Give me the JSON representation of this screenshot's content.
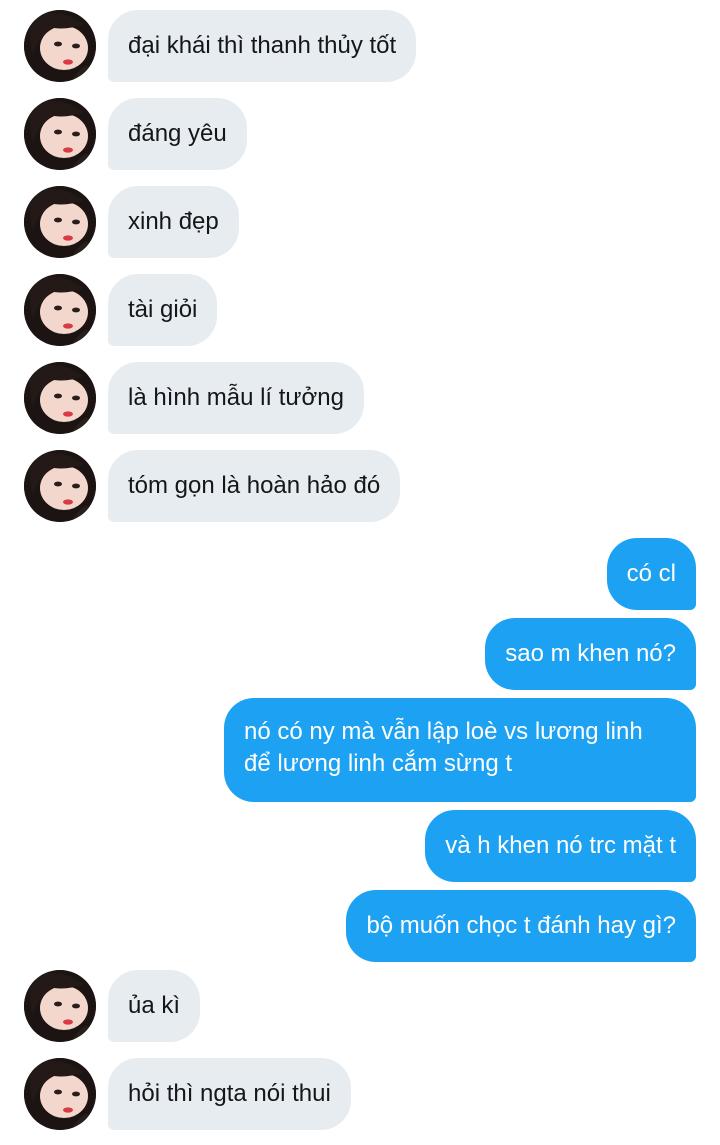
{
  "colors": {
    "incoming_bubble": "#e6ecf0",
    "outgoing_bubble": "#1da1f2",
    "incoming_text": "#14171a",
    "outgoing_text": "#ffffff"
  },
  "messages": [
    {
      "direction": "in",
      "text": "đại khái thì thanh thủy tốt"
    },
    {
      "direction": "in",
      "text": "đáng yêu"
    },
    {
      "direction": "in",
      "text": "xinh đẹp"
    },
    {
      "direction": "in",
      "text": "tài giỏi"
    },
    {
      "direction": "in",
      "text": "là hình mẫu lí tưởng"
    },
    {
      "direction": "in",
      "text": "tóm gọn là hoàn hảo đó"
    },
    {
      "direction": "out",
      "text": "có cl"
    },
    {
      "direction": "out",
      "text": "sao m khen nó?"
    },
    {
      "direction": "out",
      "text": "nó có ny mà vẫn lập loè vs lương linh để lương linh cắm sừng t"
    },
    {
      "direction": "out",
      "text": "và h khen nó trc mặt t"
    },
    {
      "direction": "out",
      "text": "bộ muốn chọc t đánh hay gì?"
    },
    {
      "direction": "in",
      "text": "ủa kì"
    },
    {
      "direction": "in",
      "text": "hỏi thì ngta nói thui"
    }
  ]
}
